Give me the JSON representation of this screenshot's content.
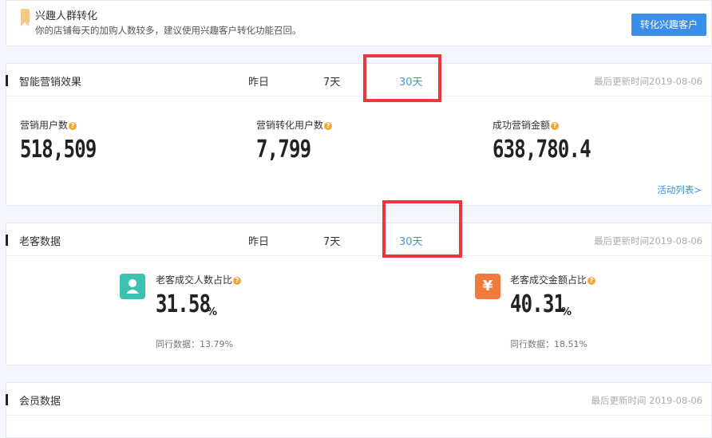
{
  "banner": {
    "title": "兴趣人群转化",
    "desc": "你的店铺每天的加购人数较多，建议使用兴趣客户转化功能召回。",
    "button": "转化兴趣客户"
  },
  "marketing": {
    "title": "智能营销效果",
    "tabs": [
      "昨日",
      "7天",
      "30天"
    ],
    "active_tab": "30天",
    "updated": "最后更新时间2019-08-06",
    "metrics": [
      {
        "label": "营销用户数",
        "value": "518,509"
      },
      {
        "label": "营销转化用户数",
        "value": "7,799"
      },
      {
        "label": "成功营销金额",
        "value": "638,780.4"
      }
    ],
    "link": "活动列表>"
  },
  "old_customer": {
    "title": "老客数据",
    "tabs": [
      "昨日",
      "7天",
      "30天"
    ],
    "active_tab": "30天",
    "updated": "最后更新时间2019-08-06",
    "metrics": [
      {
        "label": "老客成交人数占比",
        "value": "31.58",
        "unit": "%",
        "peer": "同行数据：13.79%",
        "icon": "user-icon"
      },
      {
        "label": "老客成交金额占比",
        "value": "40.31",
        "unit": "%",
        "peer": "同行数据：18.51%",
        "icon": "yen-icon",
        "icon_glyph": "¥"
      }
    ]
  },
  "member": {
    "title": "会员数据",
    "updated": "最后更新时间 2019-08-06"
  },
  "colors": {
    "accent": "#3b8ee6",
    "highlight": "#e8383d",
    "question": "#f0a83a"
  }
}
